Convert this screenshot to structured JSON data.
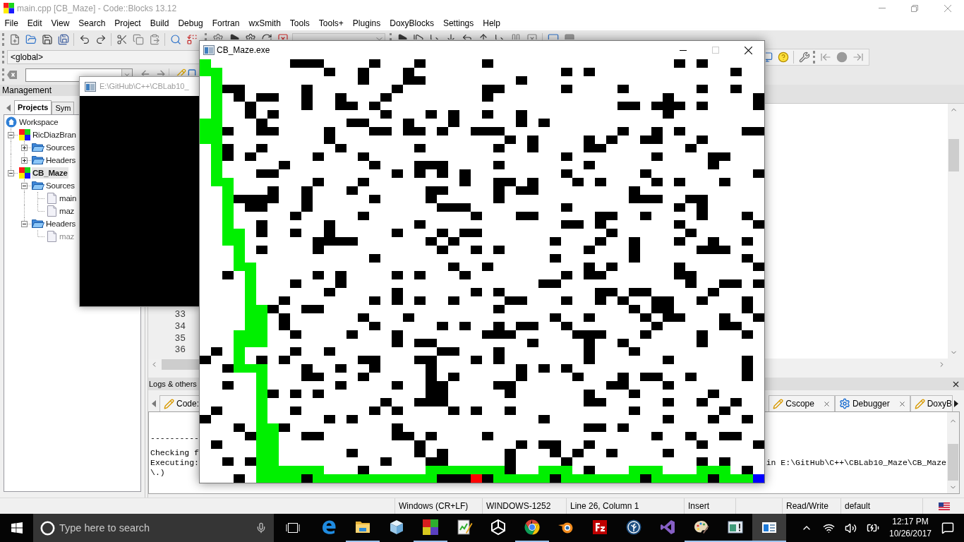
{
  "window": {
    "title": "main.cpp [CB_Maze] - Code::Blocks 13.12",
    "active": false
  },
  "menu": [
    "File",
    "Edit",
    "View",
    "Search",
    "Project",
    "Build",
    "Debug",
    "Fortran",
    "wxSmith",
    "Tools",
    "Tools+",
    "Plugins",
    "DoxyBlocks",
    "Settings",
    "Help"
  ],
  "toolbar": {
    "scope": "<global>"
  },
  "management": {
    "title": "Management",
    "tabs": [
      {
        "label": "Projects",
        "selected": true
      },
      {
        "label": "Sym",
        "selected": false
      }
    ],
    "tree": [
      {
        "kind": "workspace",
        "label": "Workspace",
        "selected": false,
        "children": [
          {
            "kind": "project",
            "label": "RicDiazBran",
            "selected": false,
            "expanded": true,
            "children": [
              {
                "kind": "folder",
                "label": "Sources",
                "selected": false,
                "expanded": false
              },
              {
                "kind": "folder",
                "label": "Headers",
                "selected": false,
                "expanded": false
              }
            ]
          },
          {
            "kind": "project",
            "label": "CB_Maze",
            "selected": true,
            "expanded": true,
            "children": [
              {
                "kind": "folder",
                "label": "Sources",
                "selected": false,
                "expanded": true,
                "children": [
                  {
                    "kind": "file",
                    "label": "main",
                    "selected": false,
                    "dimmed": false
                  },
                  {
                    "kind": "file",
                    "label": "maz",
                    "selected": false,
                    "dimmed": false
                  }
                ]
              },
              {
                "kind": "folder",
                "label": "Headers",
                "selected": false,
                "expanded": true,
                "children": [
                  {
                    "kind": "file",
                    "label": "maz",
                    "selected": false,
                    "dimmed": true
                  }
                ]
              }
            ]
          }
        ]
      }
    ]
  },
  "editor": {
    "line_numbers": [
      "33",
      "34",
      "35",
      "36"
    ]
  },
  "logs": {
    "title": "Logs & others",
    "tabs": [
      {
        "kind": "log",
        "label": "Code:",
        "close": false
      },
      {
        "kind": "log",
        "label": "Cscope",
        "close": true
      },
      {
        "kind": "debugger",
        "label": "Debugger",
        "close": true
      },
      {
        "kind": "log",
        "label": "DoxyB",
        "close": false
      }
    ],
    "lines": [
      {
        "start": "----------"
      },
      {
        "start": "Checking f"
      },
      {
        "start": "Executing:",
        "end": "in E:\\GitHub\\C++\\CBLab10_Maze\\CB_Maze"
      },
      {
        "start": "\\.)"
      }
    ]
  },
  "status_bar": {
    "fields": [
      "Windows (CR+LF)",
      "WINDOWS-1252",
      "Line 26, Column 1",
      "Insert",
      "Read/Write",
      "default"
    ]
  },
  "console_window": {
    "title": "E:\\GitHub\\C++\\CBLab10_",
    "active": false
  },
  "maze_window": {
    "title": "CB_Maze.exe",
    "active": true,
    "can_maximize": false
  },
  "taskbar": {
    "search": {
      "placeholder": "Type here to search"
    },
    "apps": [
      {
        "running": false,
        "selected": false
      },
      {
        "running": true,
        "selected": false
      },
      {
        "running": false,
        "selected": false
      },
      {
        "running": true,
        "selected": false
      },
      {
        "running": false,
        "selected": false
      },
      {
        "running": false,
        "selected": false
      },
      {
        "running": true,
        "selected": false
      },
      {
        "running": false,
        "selected": false
      },
      {
        "running": false,
        "selected": false
      },
      {
        "running": false,
        "selected": false
      },
      {
        "running": false,
        "selected": false
      },
      {
        "running": true,
        "selected": false
      },
      {
        "running": true,
        "selected": false
      },
      {
        "running": true,
        "selected": true
      }
    ],
    "time": "12:17 PM",
    "date": "10/26/2017"
  }
}
